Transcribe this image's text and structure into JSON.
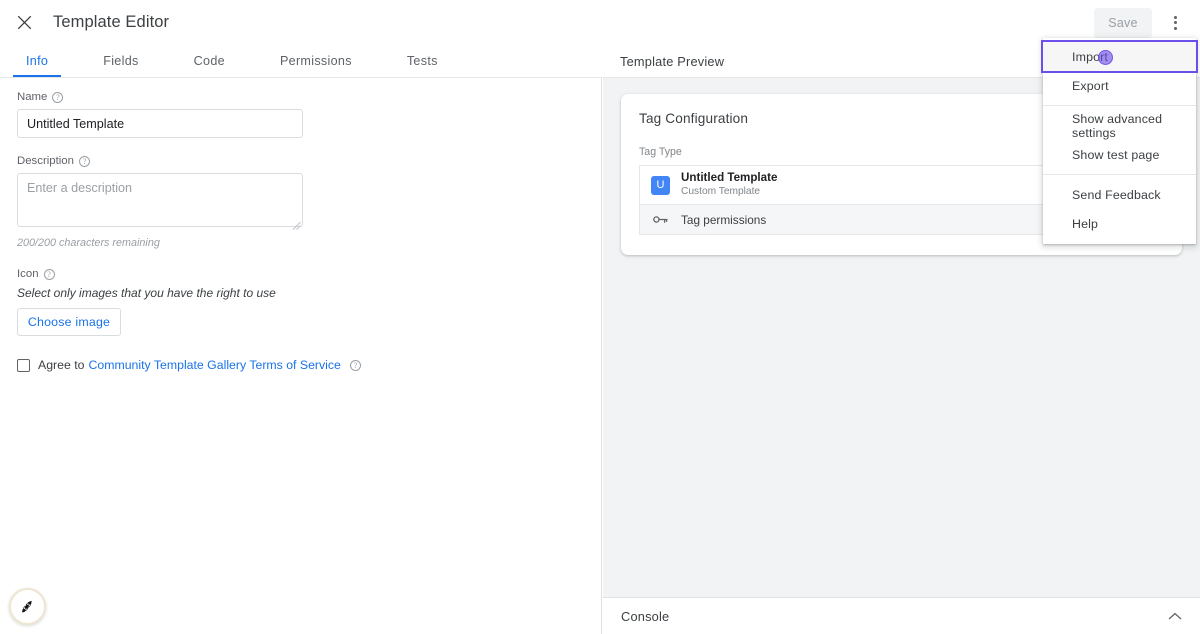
{
  "topbar": {
    "close_icon": "close-icon",
    "title": "Template Editor",
    "save_label": "Save",
    "kebab_icon": "more-vert-icon"
  },
  "tabs": [
    {
      "label": "Info",
      "active": true
    },
    {
      "label": "Fields",
      "active": false
    },
    {
      "label": "Code",
      "active": false
    },
    {
      "label": "Permissions",
      "active": false
    },
    {
      "label": "Tests",
      "active": false
    }
  ],
  "form": {
    "name": {
      "label": "Name",
      "help_icon": "help-circle-icon",
      "value": "Untitled Template"
    },
    "description": {
      "label": "Description",
      "help_icon": "help-circle-icon",
      "value": "",
      "placeholder": "Enter a description",
      "counter": "200/200 characters remaining"
    },
    "icon": {
      "label": "Icon",
      "help_icon": "help-circle-icon",
      "note": "Select only images that you have the right to use",
      "choose_label": "Choose image"
    },
    "agree": {
      "checked": false,
      "prefix": "Agree to",
      "link": "Community Template Gallery Terms of Service",
      "help_icon": "help-circle-icon"
    }
  },
  "preview": {
    "title": "Template Preview",
    "card": {
      "title": "Tag Configuration",
      "tag_type_label": "Tag Type",
      "tag_badge": "U",
      "tag_name": "Untitled Template",
      "tag_sub": "Custom Template",
      "permissions_icon": "key-icon",
      "permissions_label": "Tag permissions"
    }
  },
  "console": {
    "label": "Console",
    "chevron_icon": "chevron-up-icon"
  },
  "menu": {
    "items": [
      {
        "label": "Import",
        "highlighted": true,
        "sep_after": false
      },
      {
        "label": "Export",
        "highlighted": false,
        "sep_after": true
      },
      {
        "label": "Show advanced settings",
        "highlighted": false,
        "sep_after": false
      },
      {
        "label": "Show test page",
        "highlighted": false,
        "sep_after": true
      },
      {
        "label": "Send Feedback",
        "highlighted": false,
        "sep_after": false
      },
      {
        "label": "Help",
        "highlighted": false,
        "sep_after": false
      }
    ],
    "highlight_color": "#6c4ee8",
    "cursor_color": "#6c4ee8"
  },
  "fab": {
    "icon": "assistant-icon"
  },
  "colors": {
    "accent": "#1a73e8",
    "tag_badge": "#4285f4",
    "panel_bg": "#f1f3f4",
    "highlight": "#6c4ee8"
  }
}
